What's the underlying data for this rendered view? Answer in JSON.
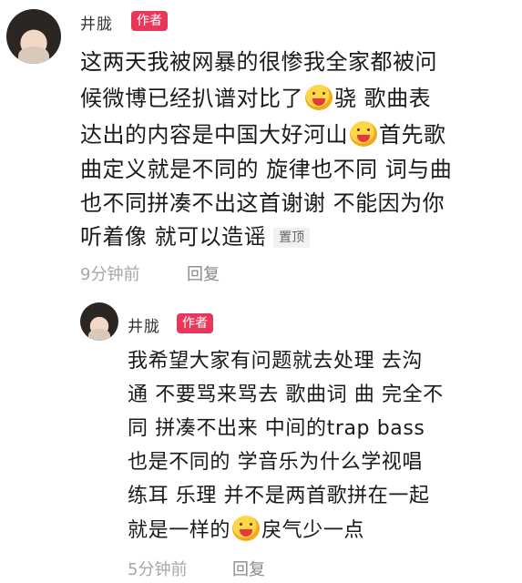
{
  "comment": {
    "author": "井胧",
    "badge": "作者",
    "lines": [
      "这两天我被网暴的很惨我全家都被问",
      "候微博已经扒谱对比了",
      "骁 歌曲表",
      "达出的内容是中国大好河山",
      "首先歌",
      "曲定义就是不同的 旋律也不同 词与曲",
      "也不同拼凑不出这首谢谢 不能因为你",
      "听着像 就可以造谣"
    ],
    "pinned_label": "置顶",
    "time": "9分钟前",
    "reply_label": "回复"
  },
  "reply_comment": {
    "author": "井胧",
    "badge": "作者",
    "lines": [
      "我希望大家有问题就去处理 去沟",
      "通 不要骂来骂去 歌曲词 曲 完全不",
      "同 拼凑不出来 中间的trap bass",
      "也是不同的 学音乐为什么学视唱",
      "练耳 乐理 并不是两首歌拼在一起",
      "就是一样的",
      "戾气少一点"
    ],
    "time": "5分钟前",
    "reply_label": "回复"
  },
  "icons": {
    "emoji": "blushing-face-icon",
    "avatar": "user-avatar"
  }
}
